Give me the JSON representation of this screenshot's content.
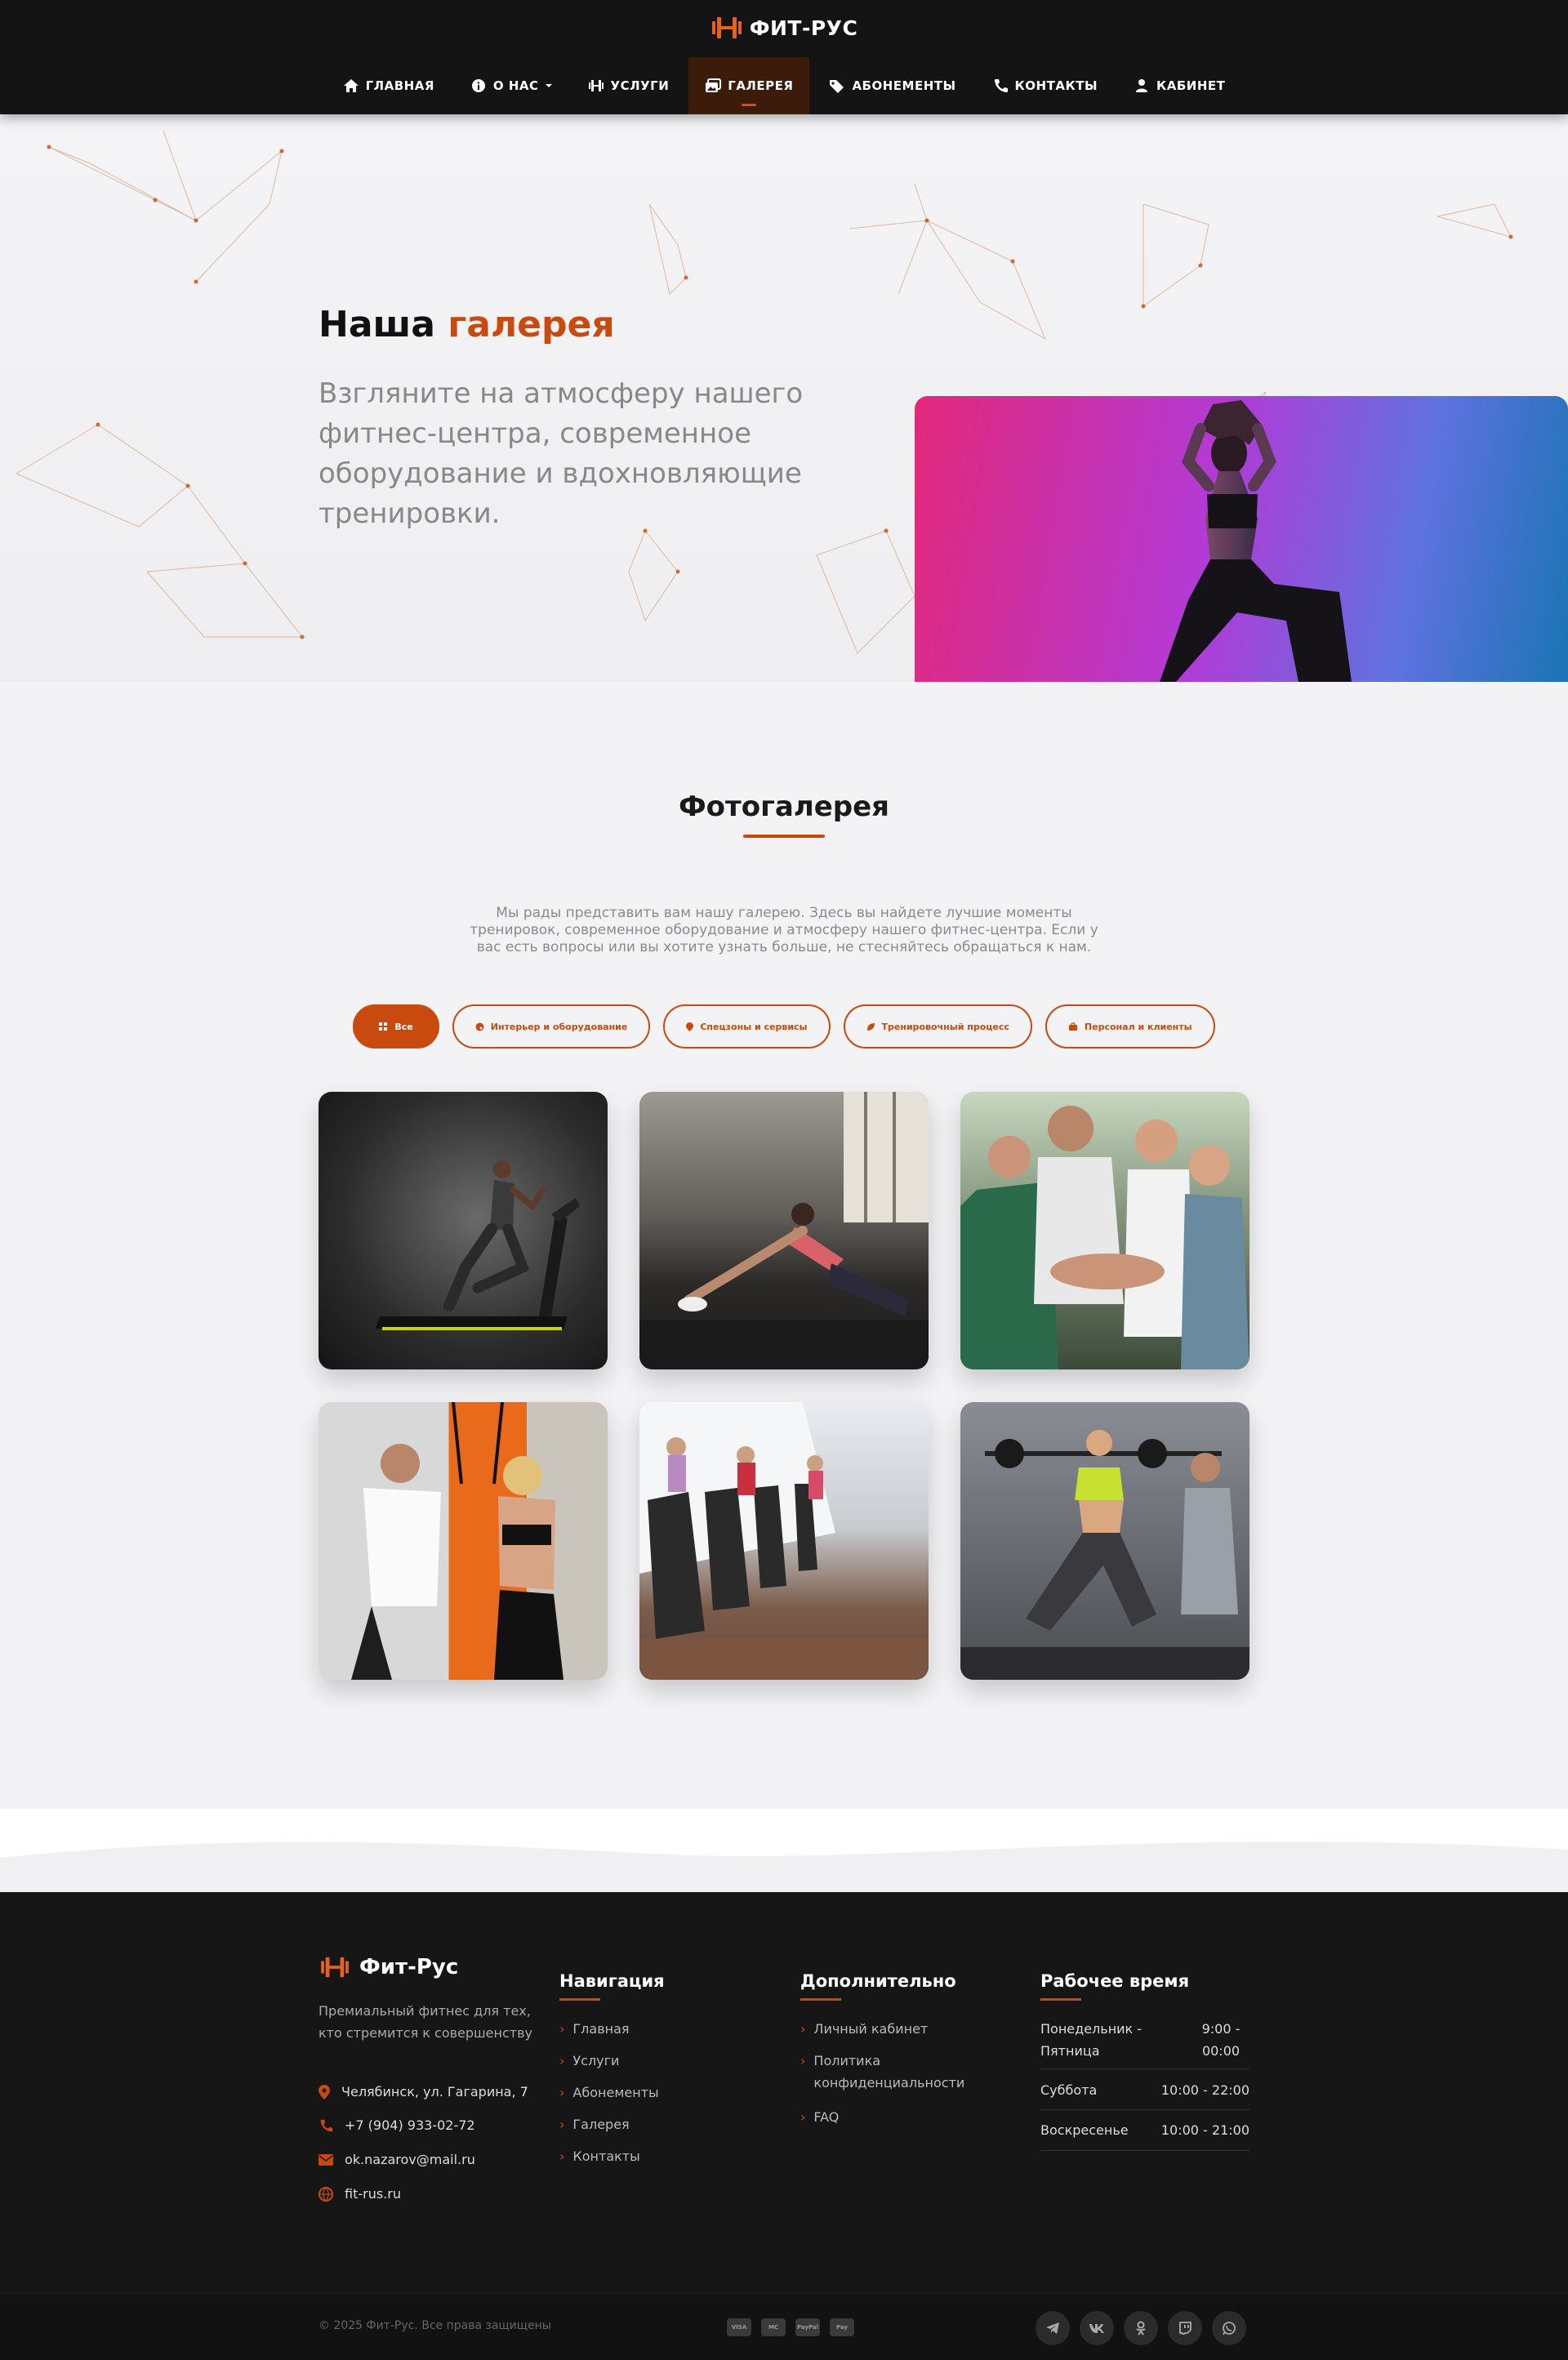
{
  "brand": {
    "name": "ФИТ-РУС",
    "accent": "#c94a0e"
  },
  "nav": {
    "items": [
      {
        "label": "ГЛАВНАЯ",
        "icon": "home-icon"
      },
      {
        "label": "О НАС",
        "icon": "info-icon"
      },
      {
        "label": "УСЛУГИ",
        "icon": "dumbbell-icon"
      },
      {
        "label": "ГАЛЕРЕЯ",
        "icon": "images-icon",
        "active": true
      },
      {
        "label": "АБОНЕМЕНТЫ",
        "icon": "tags-icon"
      },
      {
        "label": "КОНТАКТЫ",
        "icon": "phone-icon"
      },
      {
        "label": "КАБИНЕТ",
        "icon": "user-icon"
      }
    ]
  },
  "hero": {
    "title_plain": "Наша",
    "title_accent": "галерея",
    "subtitle": "Взгляните на атмосферу нашего фитнес-центра, современное оборудование и вдохновляющие тренировки."
  },
  "gallery": {
    "title": "Фотогалерея",
    "description": "Мы рады представить вам нашу галерею. Здесь вы найдете лучшие моменты тренировок, современное оборудование и атмосферу нашего фитнес-центра. Если у вас есть вопросы или вы хотите узнать больше, не стесняйтесь обращаться к нам.",
    "filters": [
      {
        "label": "Все",
        "icon": "grid-icon",
        "active": true
      },
      {
        "label": "Интерьер и оборудование",
        "icon": "palette-icon"
      },
      {
        "label": "Спецзоны и сервисы",
        "icon": "pin-icon"
      },
      {
        "label": "Тренировочный процесс",
        "icon": "leaf-icon"
      },
      {
        "label": "Персонал и клиенты",
        "icon": "people-icon"
      }
    ],
    "photos": [
      {
        "subject": "treadmill-runner"
      },
      {
        "subject": "stretching-woman"
      },
      {
        "subject": "group-hands"
      },
      {
        "subject": "trx-training"
      },
      {
        "subject": "stepper-cardio-zone"
      },
      {
        "subject": "barbell-lunge-trainer"
      }
    ]
  },
  "footer": {
    "brand": "Фит-Рус",
    "tagline": "Премиальный фитнес для тех, кто стремится к совершенству",
    "contacts": [
      {
        "icon": "map-pin-icon",
        "text": "Челябинск, ул. Гагарина, 7"
      },
      {
        "icon": "phone-icon",
        "text": "+7 (904) 933-02-72"
      },
      {
        "icon": "envelope-icon",
        "text": "ok.nazarov@mail.ru"
      },
      {
        "icon": "globe-icon",
        "text": "fit-rus.ru"
      }
    ],
    "nav_title": "Навигация",
    "nav_links": [
      "Главная",
      "Услуги",
      "Абонементы",
      "Галерея",
      "Контакты"
    ],
    "extra_title": "Дополнительно",
    "extra_links": [
      "Личный кабинет",
      "Политика конфиденциальности",
      "FAQ"
    ],
    "hours_title": "Рабочее время",
    "hours": [
      {
        "day": "Понедельник - Пятница",
        "time": "9:00 - 00:00"
      },
      {
        "day": "Суббота",
        "time": "10:00 - 22:00"
      },
      {
        "day": "Воскресенье",
        "time": "10:00 - 21:00"
      }
    ],
    "copyright": "© 2025 Фит-Рус. Все права защищены",
    "payments": [
      "VISA",
      "MC",
      "PayPal",
      "Pay"
    ],
    "social": [
      "telegram-icon",
      "vk-icon",
      "odnoklassniki-icon",
      "twitch-icon",
      "whatsapp-icon"
    ]
  }
}
